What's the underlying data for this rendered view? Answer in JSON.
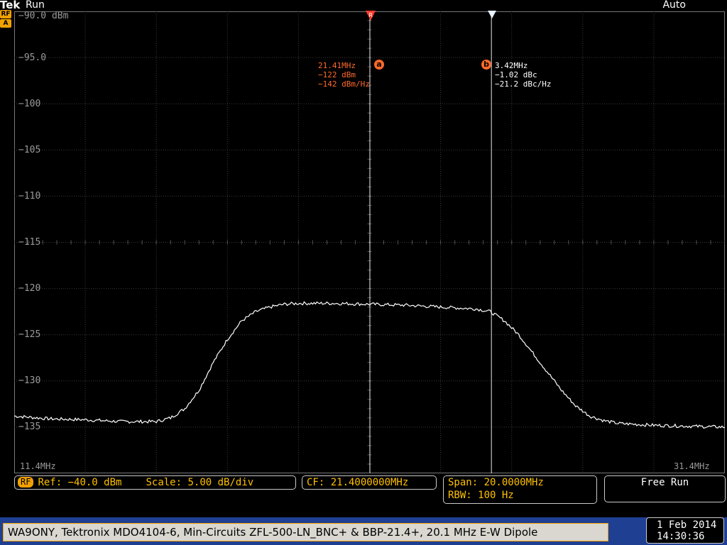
{
  "header": {
    "brand": "Tek",
    "run_state": "Run",
    "trigger_mode": "Auto"
  },
  "side_badges": [
    "RF",
    "A"
  ],
  "y_axis": {
    "unit_top": "−90.0 dBm",
    "labels": [
      "−95.0",
      "−100",
      "−105",
      "−110",
      "−115",
      "−120",
      "−125",
      "−130",
      "−135"
    ]
  },
  "x_axis": {
    "start": "11.4MHz",
    "stop": "31.4MHz"
  },
  "cursors": {
    "ref_marker": "R",
    "a": {
      "label": "a",
      "freq": "21.41MHz",
      "level": "−122 dBm",
      "density": "−142 dBm/Hz"
    },
    "b": {
      "label": "b",
      "freq": "3.42MHz",
      "level": "−1.02 dBc",
      "density": "−21.2 dBc/Hz"
    }
  },
  "status": {
    "rf_chip": "RF",
    "ref": "Ref: −40.0 dBm",
    "scale": "Scale: 5.00 dB/div",
    "cf": "CF: 21.4000000MHz",
    "span": "Span: 20.0000MHz",
    "rbw": "RBW: 100 Hz",
    "mode": "Free Run"
  },
  "footer": {
    "caption": "WA9ONY, Tektronix MDO4104-6, Min-Circuits ZFL-500-LN_BNC+ & BBP-21.4+, 20.1 MHz E-W Dipole",
    "date": "1 Feb 2014",
    "time": "14:30:36"
  },
  "chart_data": {
    "type": "line",
    "xlabel": "",
    "ylabel": "",
    "xlim": [
      11.4,
      31.4
    ],
    "ylim": [
      -140,
      -90
    ],
    "x_unit": "MHz",
    "y_unit": "dBm",
    "cursor_a_x": 21.41,
    "cursor_b_x": 24.83,
    "series": [
      {
        "x": [
          11.4,
          12.4,
          13.4,
          14.4,
          15.4,
          15.8,
          16.2,
          16.6,
          17.0,
          17.4,
          17.8,
          18.2,
          18.6,
          19.0,
          19.4,
          20.4,
          21.4,
          22.4,
          23.4,
          24.4,
          24.8,
          25.2,
          25.6,
          26.0,
          26.4,
          26.8,
          27.2,
          27.6,
          28.0,
          28.4,
          29.4,
          30.4,
          31.4
        ],
        "y": [
          -133.8,
          -134.1,
          -134.2,
          -134.4,
          -134.4,
          -134.0,
          -133.0,
          -131.0,
          -128.0,
          -125.5,
          -123.5,
          -122.5,
          -122.0,
          -121.7,
          -121.6,
          -121.6,
          -121.7,
          -121.8,
          -122.0,
          -122.2,
          -122.5,
          -123.5,
          -125.0,
          -127.0,
          -129.0,
          -131.0,
          -132.7,
          -133.8,
          -134.3,
          -134.6,
          -134.8,
          -134.9,
          -135.0
        ]
      }
    ]
  }
}
